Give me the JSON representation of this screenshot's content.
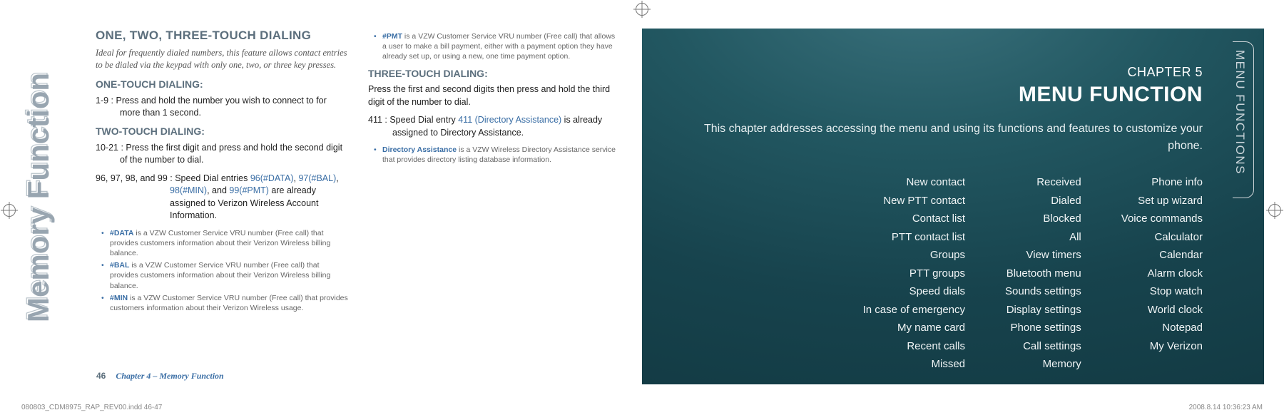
{
  "left": {
    "sideLabel": "Memory Function",
    "title": "ONE, TWO, THREE-TOUCH DIALING",
    "intro": "Ideal for frequently dialed numbers, this feature allows contact entries to be dialed via the keypad with only one, two, or three key presses.",
    "h_one": "ONE-TOUCH DIALING:",
    "p_one": "1-9 : Press and hold the number you wish to connect to for more than 1 second.",
    "h_two": "TWO-TOUCH DIALING:",
    "p_two": "10-21 : Press the first digit and press and hold the second digit of the number to dial.",
    "p_sd_prefix": "96, 97, 98, and 99 : Speed Dial entries ",
    "p_sd_a": "96(#DATA)",
    "p_sd_sep1": ", ",
    "p_sd_b": "97(#BAL)",
    "p_sd_sep2": ", ",
    "p_sd_c": "98(#MIN)",
    "p_sd_sep3": ", and ",
    "p_sd_d": "99(#PMT)",
    "p_sd_suffix": " are already assigned to Verizon Wireless Account Information.",
    "notesA": {
      "data_k": "#DATA",
      "data_t": " is a VZW Customer Service VRU number (Free call) that provides customers information about their Verizon Wireless billing balance.",
      "bal_k": "#BAL",
      "bal_t": " is a VZW Customer Service VRU number (Free call) that provides customers information about their Verizon Wireless billing balance.",
      "min_k": "#MIN",
      "min_t": " is a VZW Customer Service VRU number (Free call) that provides customers information about their Verizon Wireless usage."
    },
    "notesB": {
      "pmt_k": "#PMT",
      "pmt_t": " is a VZW Customer Service VRU number (Free call) that allows a user to make a bill payment, either with a payment option they have already set up, or using a new, one time payment option."
    },
    "h_three": "THREE-TOUCH DIALING:",
    "p_three": "Press the first and second digits then press and hold the third digit of the number to dial.",
    "p_411_a": "411 : Speed Dial entry ",
    "p_411_link": "411 (Directory Assistance)",
    "p_411_b": " is already assigned to Directory Assistance.",
    "notesC": {
      "da_k": "Directory Assistance",
      "da_t": " is a VZW Wireless Directory Assistance service that provides directory listing database information."
    },
    "footerPage": "46",
    "footerChapter": "Chapter 4 – Memory Function",
    "slugLeft": "080803_CDM8975_RAP_REV00.indd   46-47",
    "slugRight": "2008.8.14   10:36:23 AM"
  },
  "right": {
    "sideTab": "MENU FUNCTIONS",
    "chapterLabel": "CHAPTER 5",
    "chapterTitle": "MENU FUNCTION",
    "chapterDesc": "This chapter addresses accessing the menu and using its functions and features to customize your phone.",
    "col1": [
      "New contact",
      "New PTT contact",
      "Contact list",
      "PTT contact list",
      "Groups",
      "PTT groups",
      "Speed dials",
      "In case of emergency",
      "My name card",
      "Recent calls",
      "Missed"
    ],
    "col2": [
      "Received",
      "Dialed",
      "Blocked",
      "All",
      "View timers",
      "Bluetooth menu",
      "Sounds settings",
      "Display settings",
      "Phone settings",
      "Call settings",
      "Memory"
    ],
    "col3": [
      "Phone info",
      "Set up wizard",
      "Voice commands",
      "Calculator",
      "Calendar",
      "Alarm clock",
      "Stop watch",
      "World clock",
      "Notepad",
      "My Verizon"
    ]
  }
}
